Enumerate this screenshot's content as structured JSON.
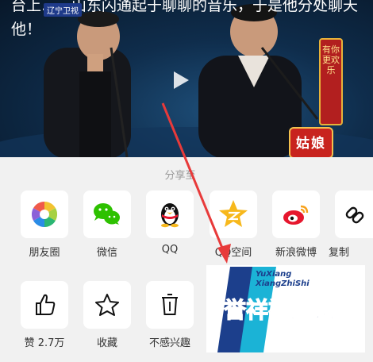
{
  "video": {
    "caption_text": "台上……山东闪通起于聊聊的音乐，于是他分处聊天他！",
    "channel_logo": "辽宁卫视",
    "banner_right": "有你更欢乐",
    "banner_bottom": "姑娘"
  },
  "share_sheet": {
    "title": "分享至",
    "row1": [
      {
        "label": "朋友圈",
        "icon": "moments-aperture-icon"
      },
      {
        "label": "微信",
        "icon": "wechat-icon"
      },
      {
        "label": "QQ",
        "icon": "qq-penguin-icon"
      },
      {
        "label": "QQ空间",
        "icon": "qzone-star-icon"
      },
      {
        "label": "新浪微博",
        "icon": "weibo-icon"
      },
      {
        "label": "复制",
        "icon": "link-icon"
      }
    ],
    "row2": [
      {
        "label": "赞 2.7万",
        "icon": "thumbs-up-icon"
      },
      {
        "label": "收藏",
        "icon": "star-icon"
      },
      {
        "label": "不感兴趣",
        "icon": "trash-icon"
      }
    ]
  },
  "watermark": {
    "latin_line1": "YuXiang",
    "latin_line2": "XiangZhiShi",
    "chinese": "誉祥祥知识"
  },
  "colors": {
    "arrow": "#e83a3a",
    "wechat_green": "#2dc100",
    "weibo_red": "#e6162d",
    "qzone_yellow": "#f7b81c",
    "watermark_blue": "#1c3f8c",
    "watermark_cyan": "#1bb3d6"
  }
}
